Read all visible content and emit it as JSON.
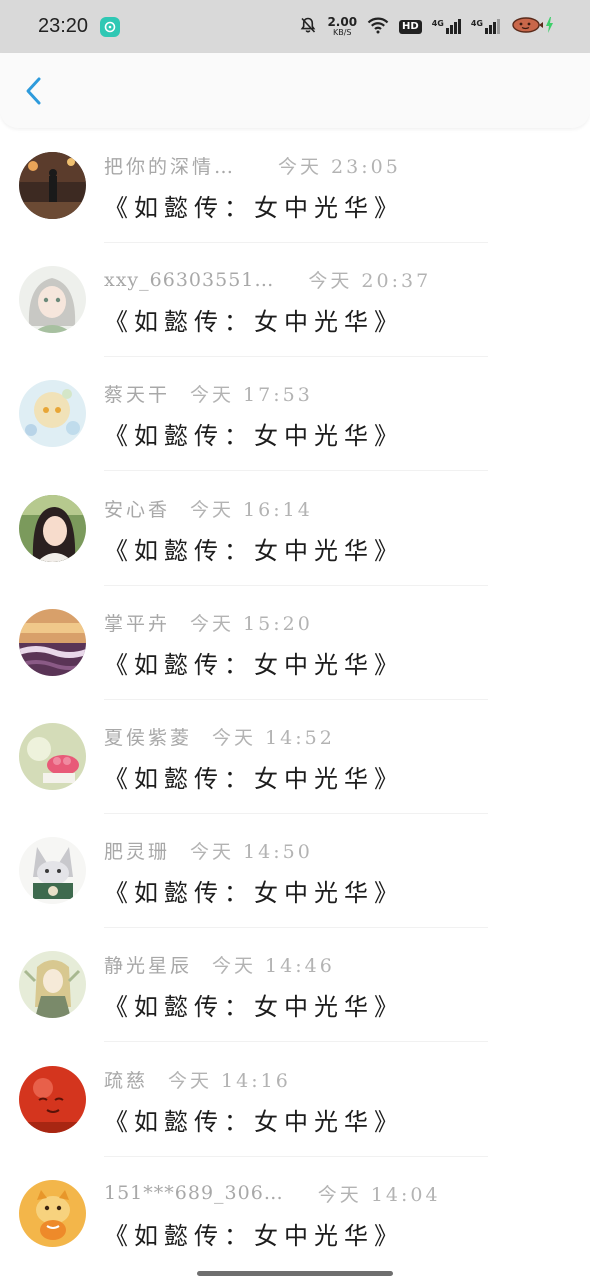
{
  "status_bar": {
    "time": "23:20",
    "net_speed": "2.00",
    "net_speed_unit": "KB/S",
    "hd_label": "HD",
    "sim1_label": "4G",
    "sim2_label": "4G",
    "colors": {
      "background": "#d9d9d9",
      "app_icon": "#2fc8b4",
      "charging": "#3ecf6a"
    }
  },
  "header": {
    "back_icon": "chevron-left-icon",
    "accent": "#2e9bdc"
  },
  "messages": [
    {
      "name": "把你的深情…",
      "time": "今天 23:05",
      "text": "《如懿传：女中光华》"
    },
    {
      "name": "xxy_66303551…",
      "time": "今天 20:37",
      "text": "《如懿传：女中光华》"
    },
    {
      "name": "蔡天干",
      "time": "今天 17:53",
      "text": "《如懿传：女中光华》"
    },
    {
      "name": "安心香",
      "time": "今天 16:14",
      "text": "《如懿传：女中光华》"
    },
    {
      "name": "掌平卉",
      "time": "今天 15:20",
      "text": "《如懿传：女中光华》"
    },
    {
      "name": "夏侯紫菱",
      "time": "今天 14:52",
      "text": "《如懿传：女中光华》"
    },
    {
      "name": "肥灵珊",
      "time": "今天 14:50",
      "text": "《如懿传：女中光华》"
    },
    {
      "name": "静光星辰",
      "time": "今天 14:46",
      "text": "《如懿传：女中光华》"
    },
    {
      "name": "疏慈",
      "time": "今天 14:16",
      "text": "《如懿传：女中光华》"
    },
    {
      "name": "151***689_306…",
      "time": "今天 14:04",
      "text": "《如懿传：女中光华》"
    }
  ]
}
